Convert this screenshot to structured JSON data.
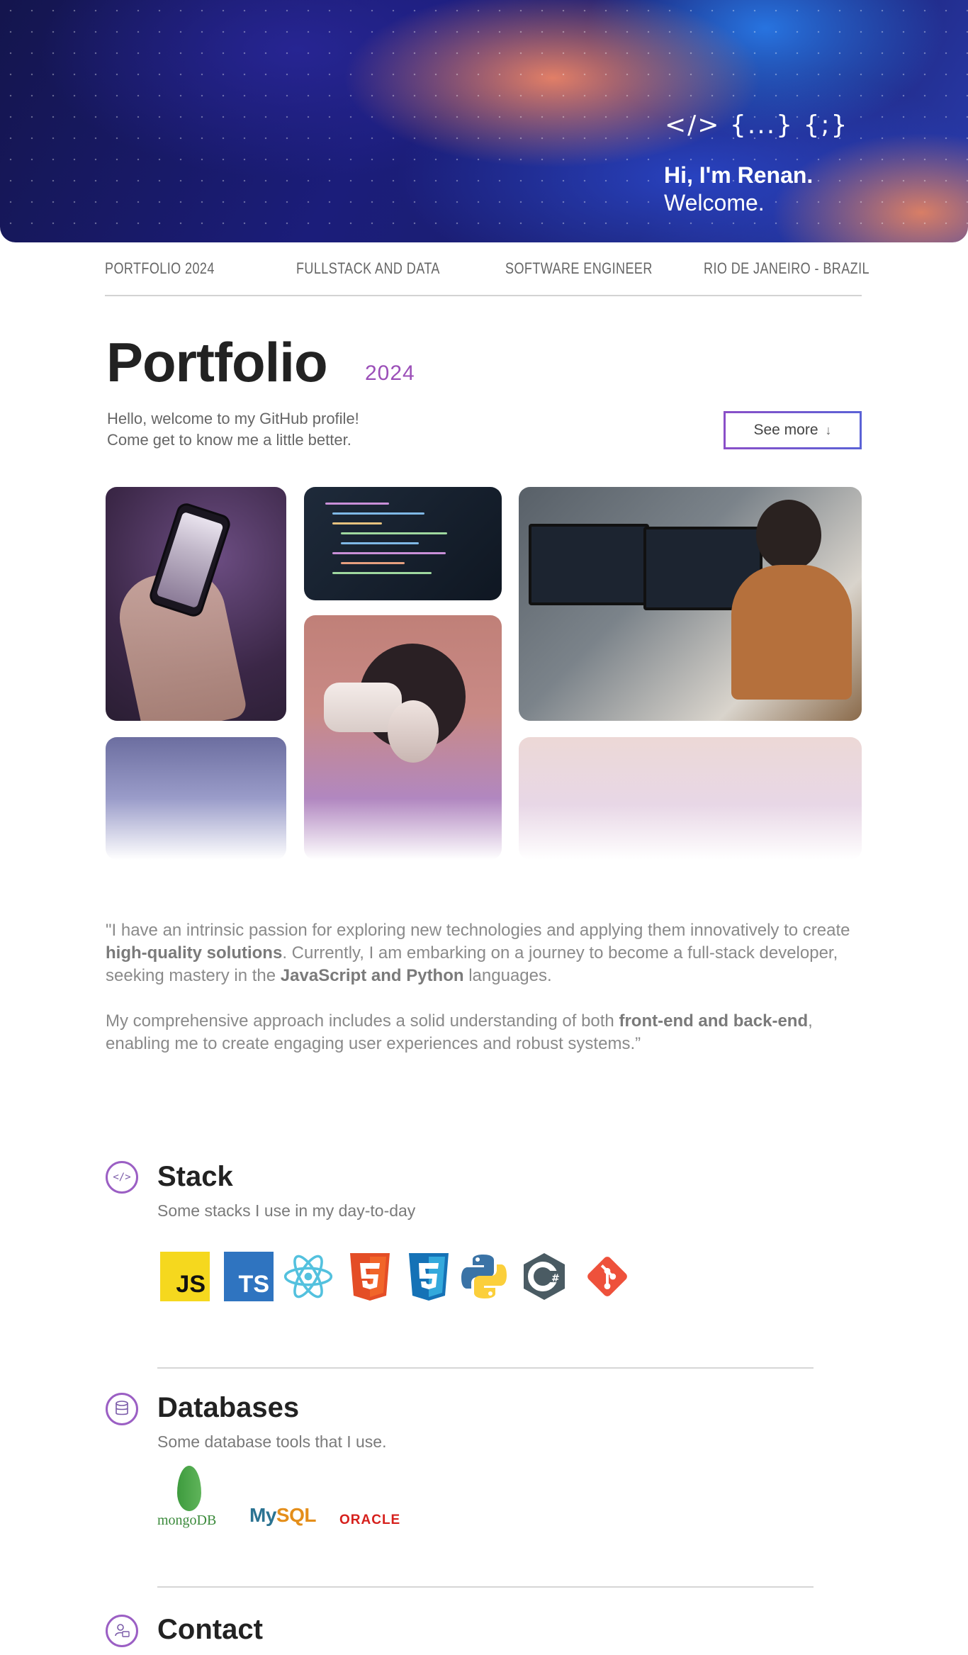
{
  "hero": {
    "symbols": "</> {...} {;}",
    "greeting": "Hi, I'm Renan.",
    "welcome": "Welcome."
  },
  "infobar": {
    "items": [
      "PORTFOLIO 2024",
      "FULLSTACK AND DATA",
      "SOFTWARE ENGINEER",
      "RIO DE JANEIRO - BRAZIL"
    ]
  },
  "header": {
    "title": "Portfolio",
    "year": "2024",
    "intro_line1": "Hello, welcome to my GitHub profile!",
    "intro_line2": "Come get to know me a little better.",
    "see_more_label": "See more",
    "see_more_arrow": "↓"
  },
  "quote": {
    "p1_a": "\"I have an intrinsic passion for exploring new technologies and applying them innovatively to create ",
    "p1_b": "high-quality solutions",
    "p1_c": ". Currently, I am embarking on a journey to become a full-stack developer, seeking mastery in the ",
    "p1_d": "JavaScript and Python",
    "p1_e": " languages.",
    "p2_a": "My comprehensive approach includes a solid understanding of both ",
    "p2_b": "front-end and back-end",
    "p2_c": ", enabling me to create engaging user experiences and robust systems.”"
  },
  "stack": {
    "icon": "code-icon",
    "title": "Stack",
    "subtitle": "Some stacks I use in my day-to-day",
    "logos": [
      "JS",
      "TS",
      "react-logo",
      "html5-logo",
      "css3-logo",
      "python-logo",
      "csharp-logo",
      "git-logo"
    ]
  },
  "databases": {
    "icon": "database-icon",
    "title": "Databases",
    "subtitle": "Some database tools that I use.",
    "mongo": "mongoDB",
    "mysql_a": "My",
    "mysql_b": "SQL",
    "oracle": "ORACLE"
  },
  "contact": {
    "icon": "contact-icon",
    "title": "Contact"
  },
  "colors": {
    "accent": "#9b5fc4",
    "text": "#222222",
    "muted": "#7a7a7a"
  }
}
